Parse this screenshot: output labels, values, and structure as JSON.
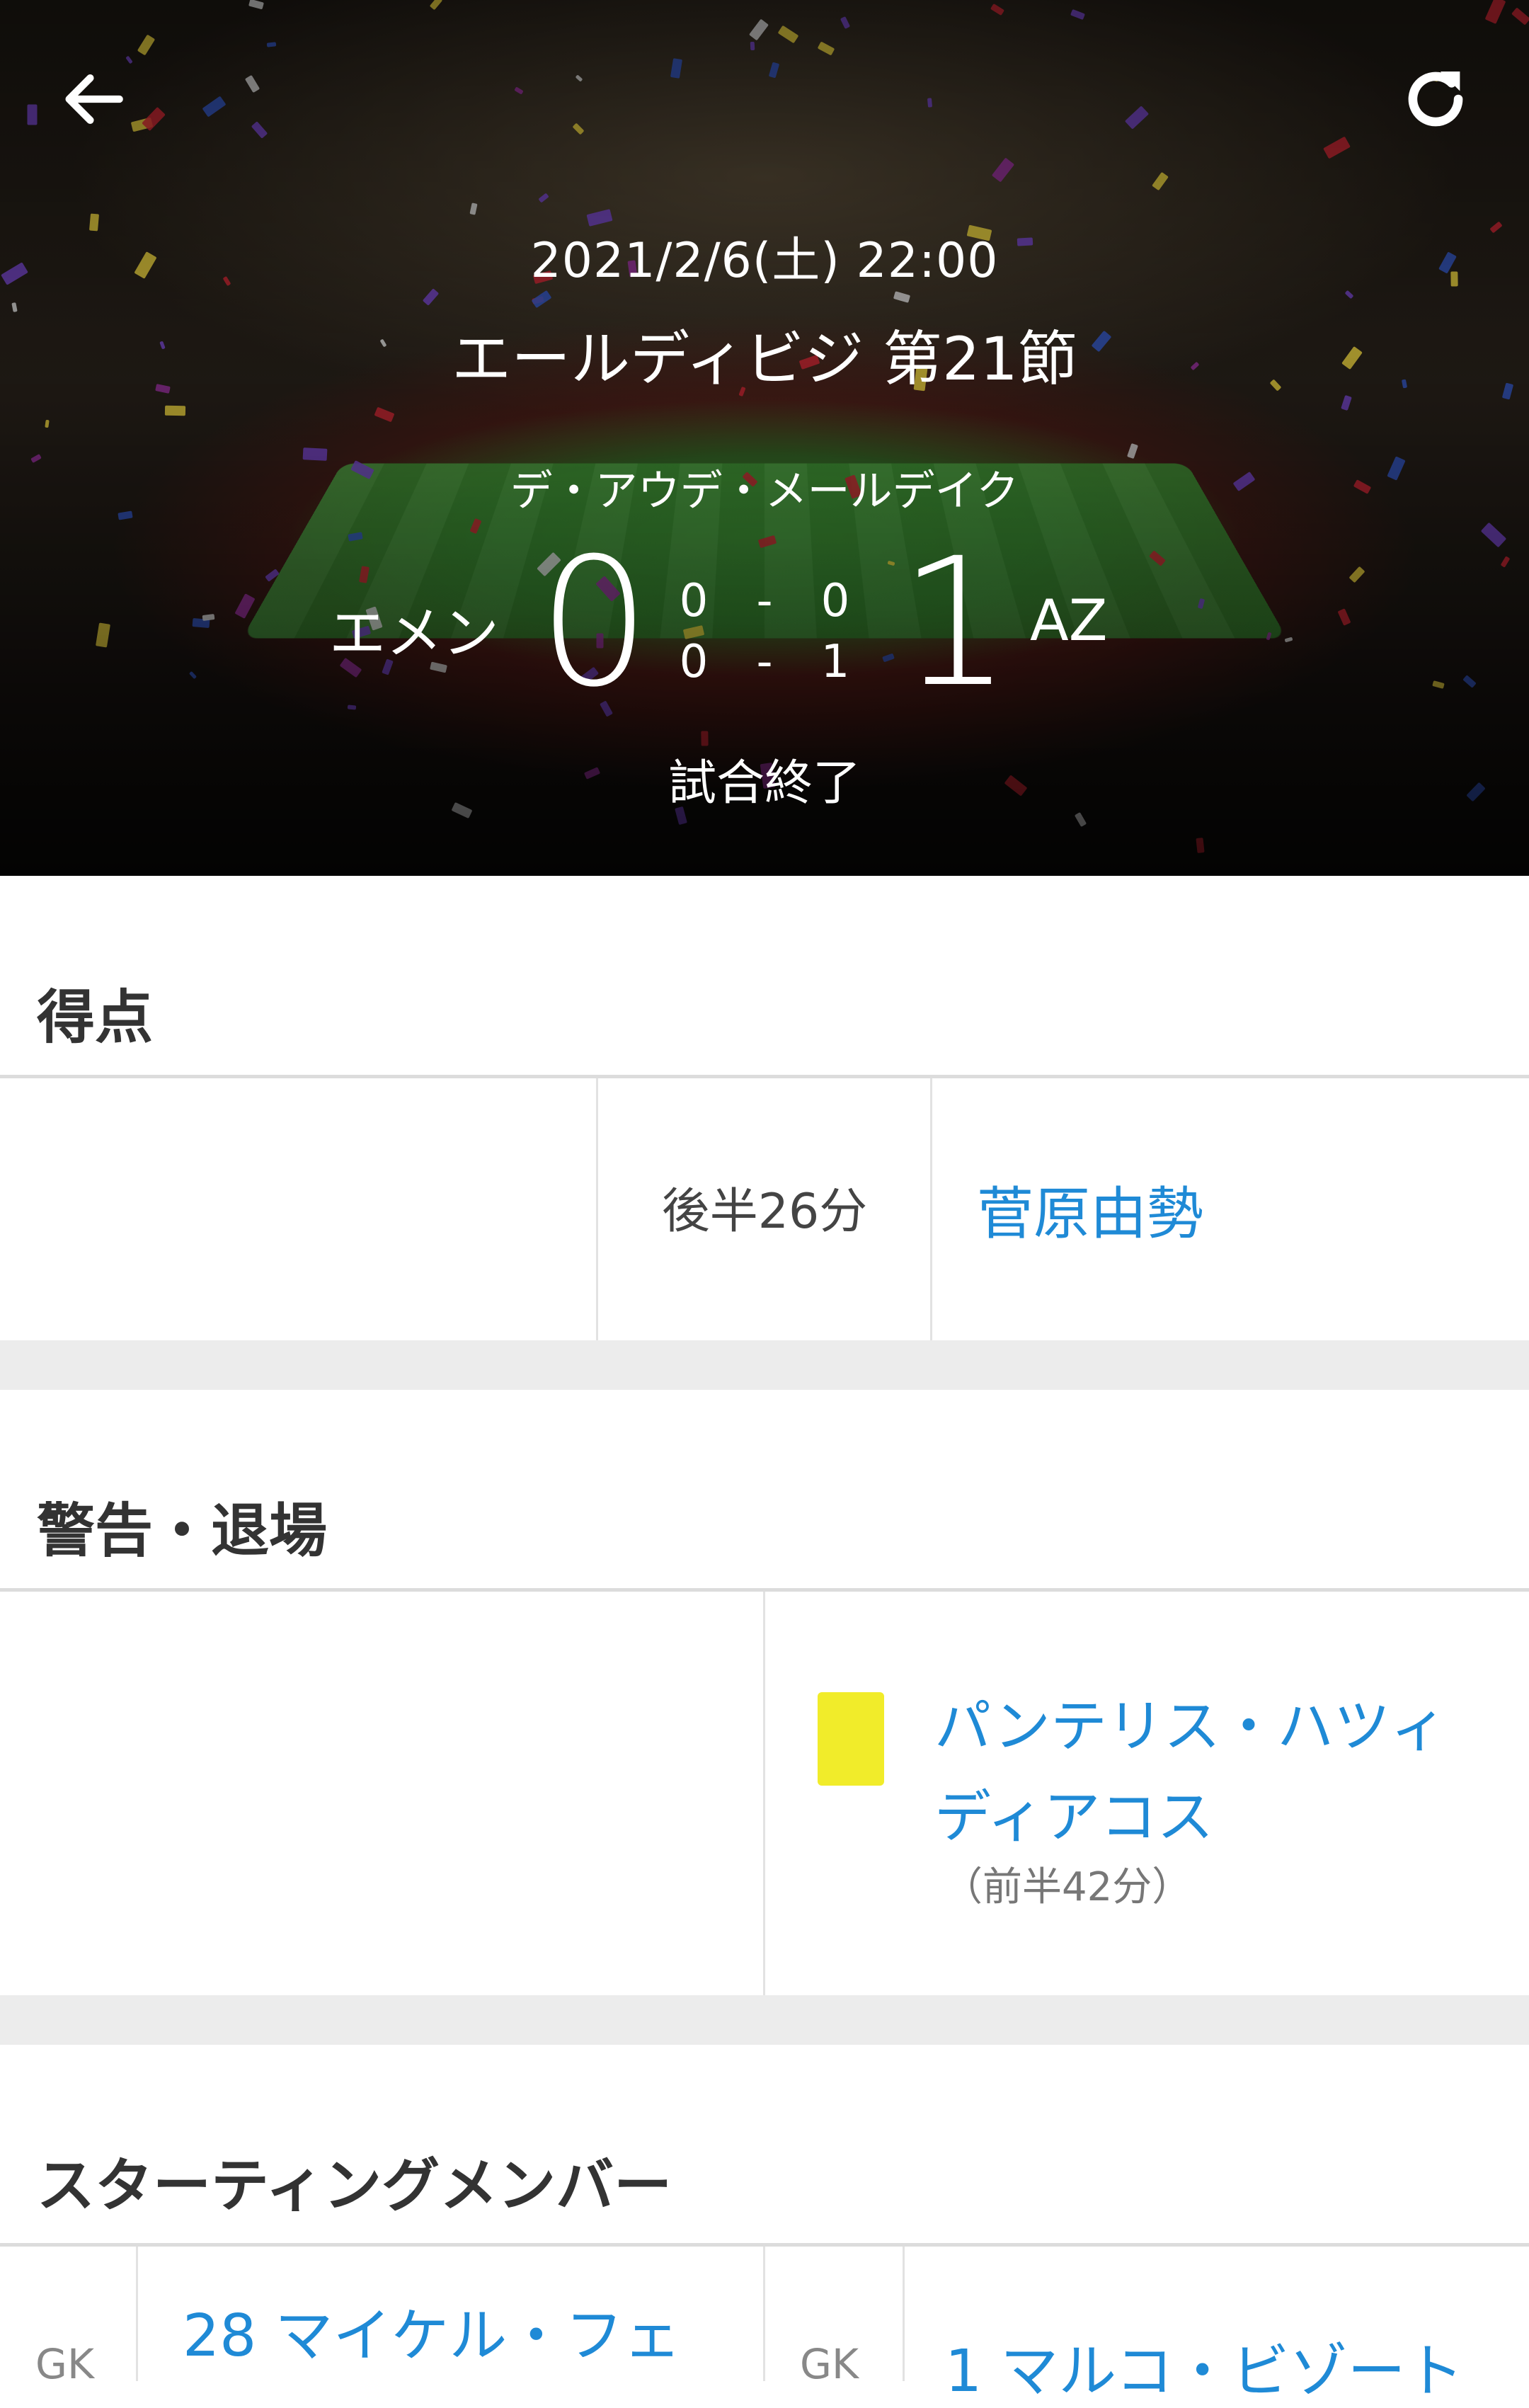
{
  "header": {
    "back_icon": "arrow-left-icon",
    "refresh_icon": "refresh-icon",
    "datetime": "2021/2/6(土) 22:00",
    "league": "エールディビジ 第21節",
    "stadium": "デ・アウデ・メールデイク",
    "home_team": "エメン",
    "away_team": "AZ",
    "home_score": "0",
    "away_score": "1",
    "first_half": {
      "home": "0",
      "sep": "-",
      "away": "0"
    },
    "second_half": {
      "home": "0",
      "sep": "-",
      "away": "1"
    },
    "status": "試合終了"
  },
  "goals": {
    "title": "得点",
    "items": [
      {
        "time": "後半26分",
        "player": "菅原由勢"
      }
    ]
  },
  "cards": {
    "title": "警告・退場",
    "items": [
      {
        "type": "yellow",
        "color": "#f1ec2a",
        "player": "パンテリス・ハツィディアコス",
        "time": "（前半42分）"
      }
    ]
  },
  "lineup": {
    "title": "スターティングメンバー",
    "home": [
      {
        "pos": "GK",
        "player": "28 マイケル・フェ"
      }
    ],
    "away": [
      {
        "pos": "GK",
        "player": "1 マルコ・ビゾート"
      }
    ]
  },
  "colors": {
    "link": "#1f8ad6",
    "yellow_card": "#f1ec2a",
    "section_gap": "#ececec"
  }
}
